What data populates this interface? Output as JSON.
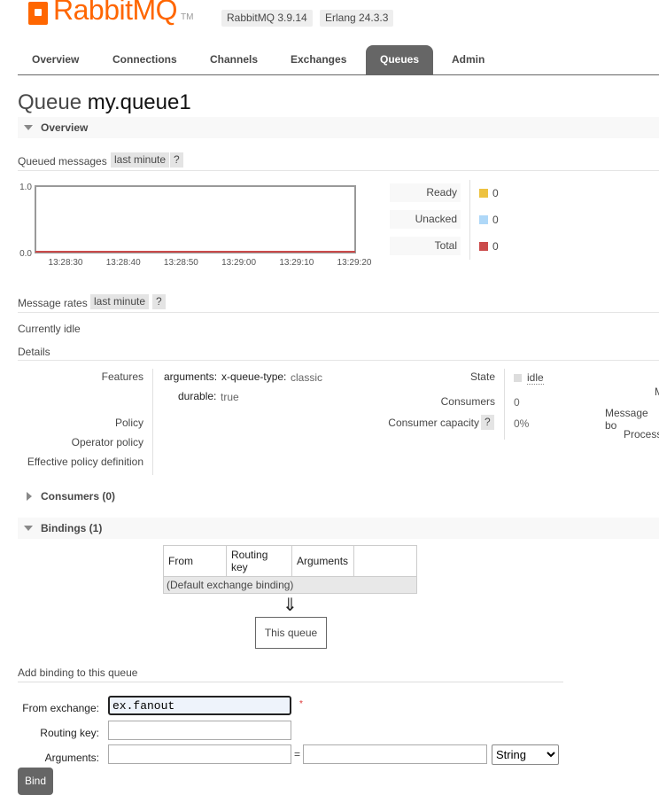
{
  "header": {
    "brand": "RabbitMQ",
    "tm": "TM",
    "rabbitmq_version": "RabbitMQ 3.9.14",
    "erlang_version": "Erlang 24.3.3"
  },
  "tabs": [
    {
      "label": "Overview"
    },
    {
      "label": "Connections"
    },
    {
      "label": "Channels"
    },
    {
      "label": "Exchanges"
    },
    {
      "label": "Queues",
      "active": true
    },
    {
      "label": "Admin"
    }
  ],
  "title": {
    "prefix": "Queue",
    "name": "my.queue1"
  },
  "overview": {
    "label": "Overview",
    "queued_messages": "Queued messages",
    "range": "last minute",
    "help": "?",
    "legend": [
      {
        "label": "Ready",
        "value": "0",
        "color": "#edc240"
      },
      {
        "label": "Unacked",
        "value": "0",
        "color": "#afd8f8"
      },
      {
        "label": "Total",
        "value": "0",
        "color": "#cb4b4b"
      }
    ],
    "message_rates": "Message rates",
    "rates_range": "last minute",
    "rates_help": "?",
    "idle": "Currently idle",
    "details": "Details"
  },
  "chart_data": {
    "type": "line",
    "x": [
      "13:28:30",
      "13:28:40",
      "13:28:50",
      "13:29:00",
      "13:29:10",
      "13:29:20"
    ],
    "series": [
      {
        "name": "Total",
        "values": [
          0,
          0,
          0,
          0,
          0,
          0
        ],
        "color": "#cb4b4b"
      }
    ],
    "ylim": [
      0.0,
      1.0
    ],
    "yticks": [
      "1.0",
      "0.0"
    ]
  },
  "details": {
    "features_label": "Features",
    "arguments_label": "arguments:",
    "xqt_key": "x-queue-type:",
    "xqt_value": "classic",
    "durable_key": "durable:",
    "durable_value": "true",
    "policy_label": "Policy",
    "operator_policy_label": "Operator policy",
    "effective_policy_label": "Effective policy definition",
    "state_label": "State",
    "state_value": "idle",
    "consumers_label": "Consumers",
    "consumers_value": "0",
    "capacity_label": "Consumer capacity",
    "capacity_help": "?",
    "capacity_value": "0%",
    "cut_m": "M",
    "cut_message_bo": "Message bo",
    "cut_process": "Process"
  },
  "consumers": {
    "label": "Consumers (0)"
  },
  "bindings": {
    "label": "Bindings (1)",
    "columns": [
      "From",
      "Routing key",
      "Arguments",
      ""
    ],
    "row": "(Default exchange binding)",
    "arrow": "⇓",
    "this_queue": "This queue"
  },
  "add_binding": {
    "title": "Add binding to this queue",
    "from_label": "From exchange:",
    "from_value": "ex.fanout",
    "required": "*",
    "routing_label": "Routing key:",
    "routing_value": "",
    "args_label": "Arguments:",
    "args_key": "",
    "equals": "=",
    "args_value": "",
    "type_options": [
      "String"
    ],
    "bind_label": "Bind"
  }
}
